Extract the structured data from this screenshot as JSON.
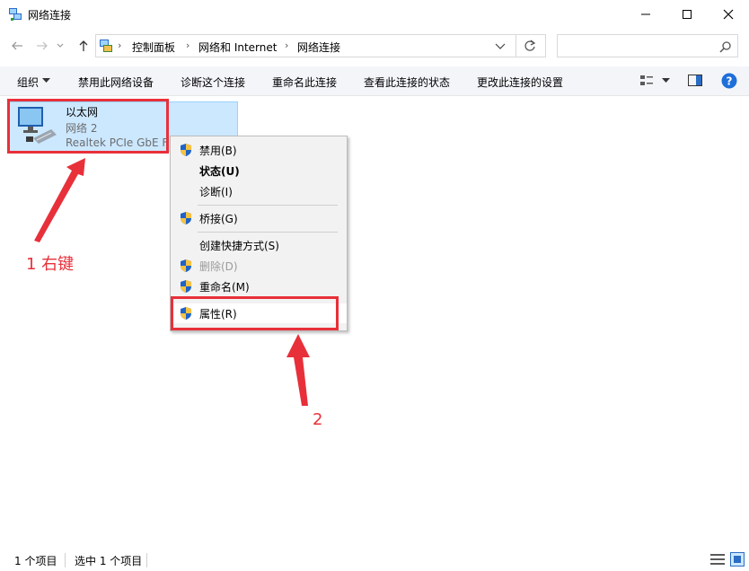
{
  "window": {
    "title": "网络连接"
  },
  "address": {
    "crumbs": [
      "控制面板",
      "网络和 Internet",
      "网络连接"
    ],
    "search_placeholder": ""
  },
  "toolbar": {
    "items": [
      "组织",
      "禁用此网络设备",
      "诊断这个连接",
      "重命名此连接",
      "查看此连接的状态",
      "更改此连接的设置"
    ]
  },
  "adapter": {
    "name": "以太网",
    "network": "网络 2",
    "device": "Realtek PCIe GbE F"
  },
  "context_menu": {
    "items": [
      {
        "label": "禁用(B)",
        "icon": "shield-icon",
        "style": "normal"
      },
      {
        "label": "状态(U)",
        "icon": "",
        "style": "bold"
      },
      {
        "label": "诊断(I)",
        "icon": "",
        "style": "normal"
      },
      {
        "label": "桥接(G)",
        "icon": "shield-icon",
        "style": "normal"
      },
      {
        "label": "创建快捷方式(S)",
        "icon": "",
        "style": "normal"
      },
      {
        "label": "删除(D)",
        "icon": "shield-icon",
        "style": "disabled"
      },
      {
        "label": "重命名(M)",
        "icon": "shield-icon",
        "style": "normal"
      },
      {
        "label": "属性(R)",
        "icon": "shield-icon",
        "style": "normal"
      }
    ]
  },
  "annotations": {
    "step1": "1 右键",
    "step2": "2"
  },
  "status": {
    "count": "1 个项目",
    "selected": "选中 1 个项目"
  },
  "colors": {
    "selection_bg": "#cce8ff",
    "annotation_red": "#e8303a",
    "help_blue": "#1e6fd9"
  }
}
